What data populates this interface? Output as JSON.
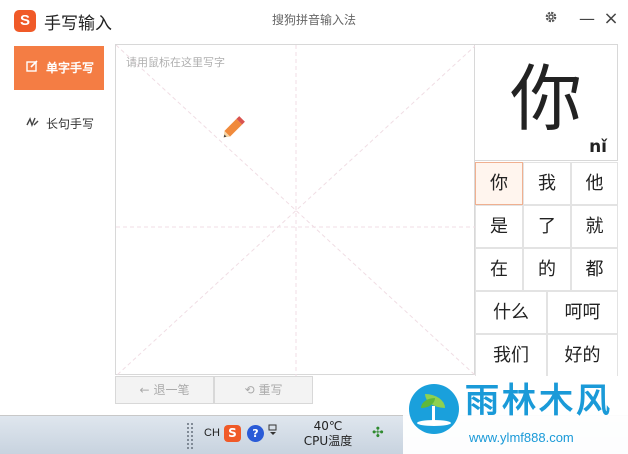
{
  "titlebar": {
    "logo_letter": "S",
    "app_title": "手写输入",
    "window_title": "搜狗拼音输入法",
    "settings_icon": "gear-icon",
    "minimize_glyph": "—",
    "close_glyph": "×"
  },
  "sidebar": {
    "items": [
      {
        "label": "单字手写",
        "icon": "edit-icon",
        "active": true
      },
      {
        "label": "长句手写",
        "icon": "scribble-icon",
        "active": false
      }
    ]
  },
  "pad": {
    "placeholder": "请用鼠标在这里写字",
    "pencil_icon": "pencil-icon",
    "back_label": "退一笔",
    "rewrite_label": "重写"
  },
  "preview": {
    "char": "你",
    "pinyin": "nǐ"
  },
  "candidates": {
    "selected": "你",
    "rows": [
      [
        "你",
        "我",
        "他"
      ],
      [
        "是",
        "了",
        "就"
      ],
      [
        "在",
        "的",
        "都"
      ],
      [
        "什么",
        "呵呵"
      ],
      [
        "我们",
        "好的"
      ]
    ]
  },
  "taskbar": {
    "lang": "CH",
    "sogou_letter": "S",
    "help_glyph": "?",
    "temp_value": "40℃",
    "temp_label": "CPU温度"
  },
  "watermark": {
    "title": "雨林木风",
    "url": "www.ylmf888.com"
  },
  "colors": {
    "accent": "#f47d44",
    "sogou_red": "#f05a28",
    "watermark_blue": "#1a9ad8"
  }
}
